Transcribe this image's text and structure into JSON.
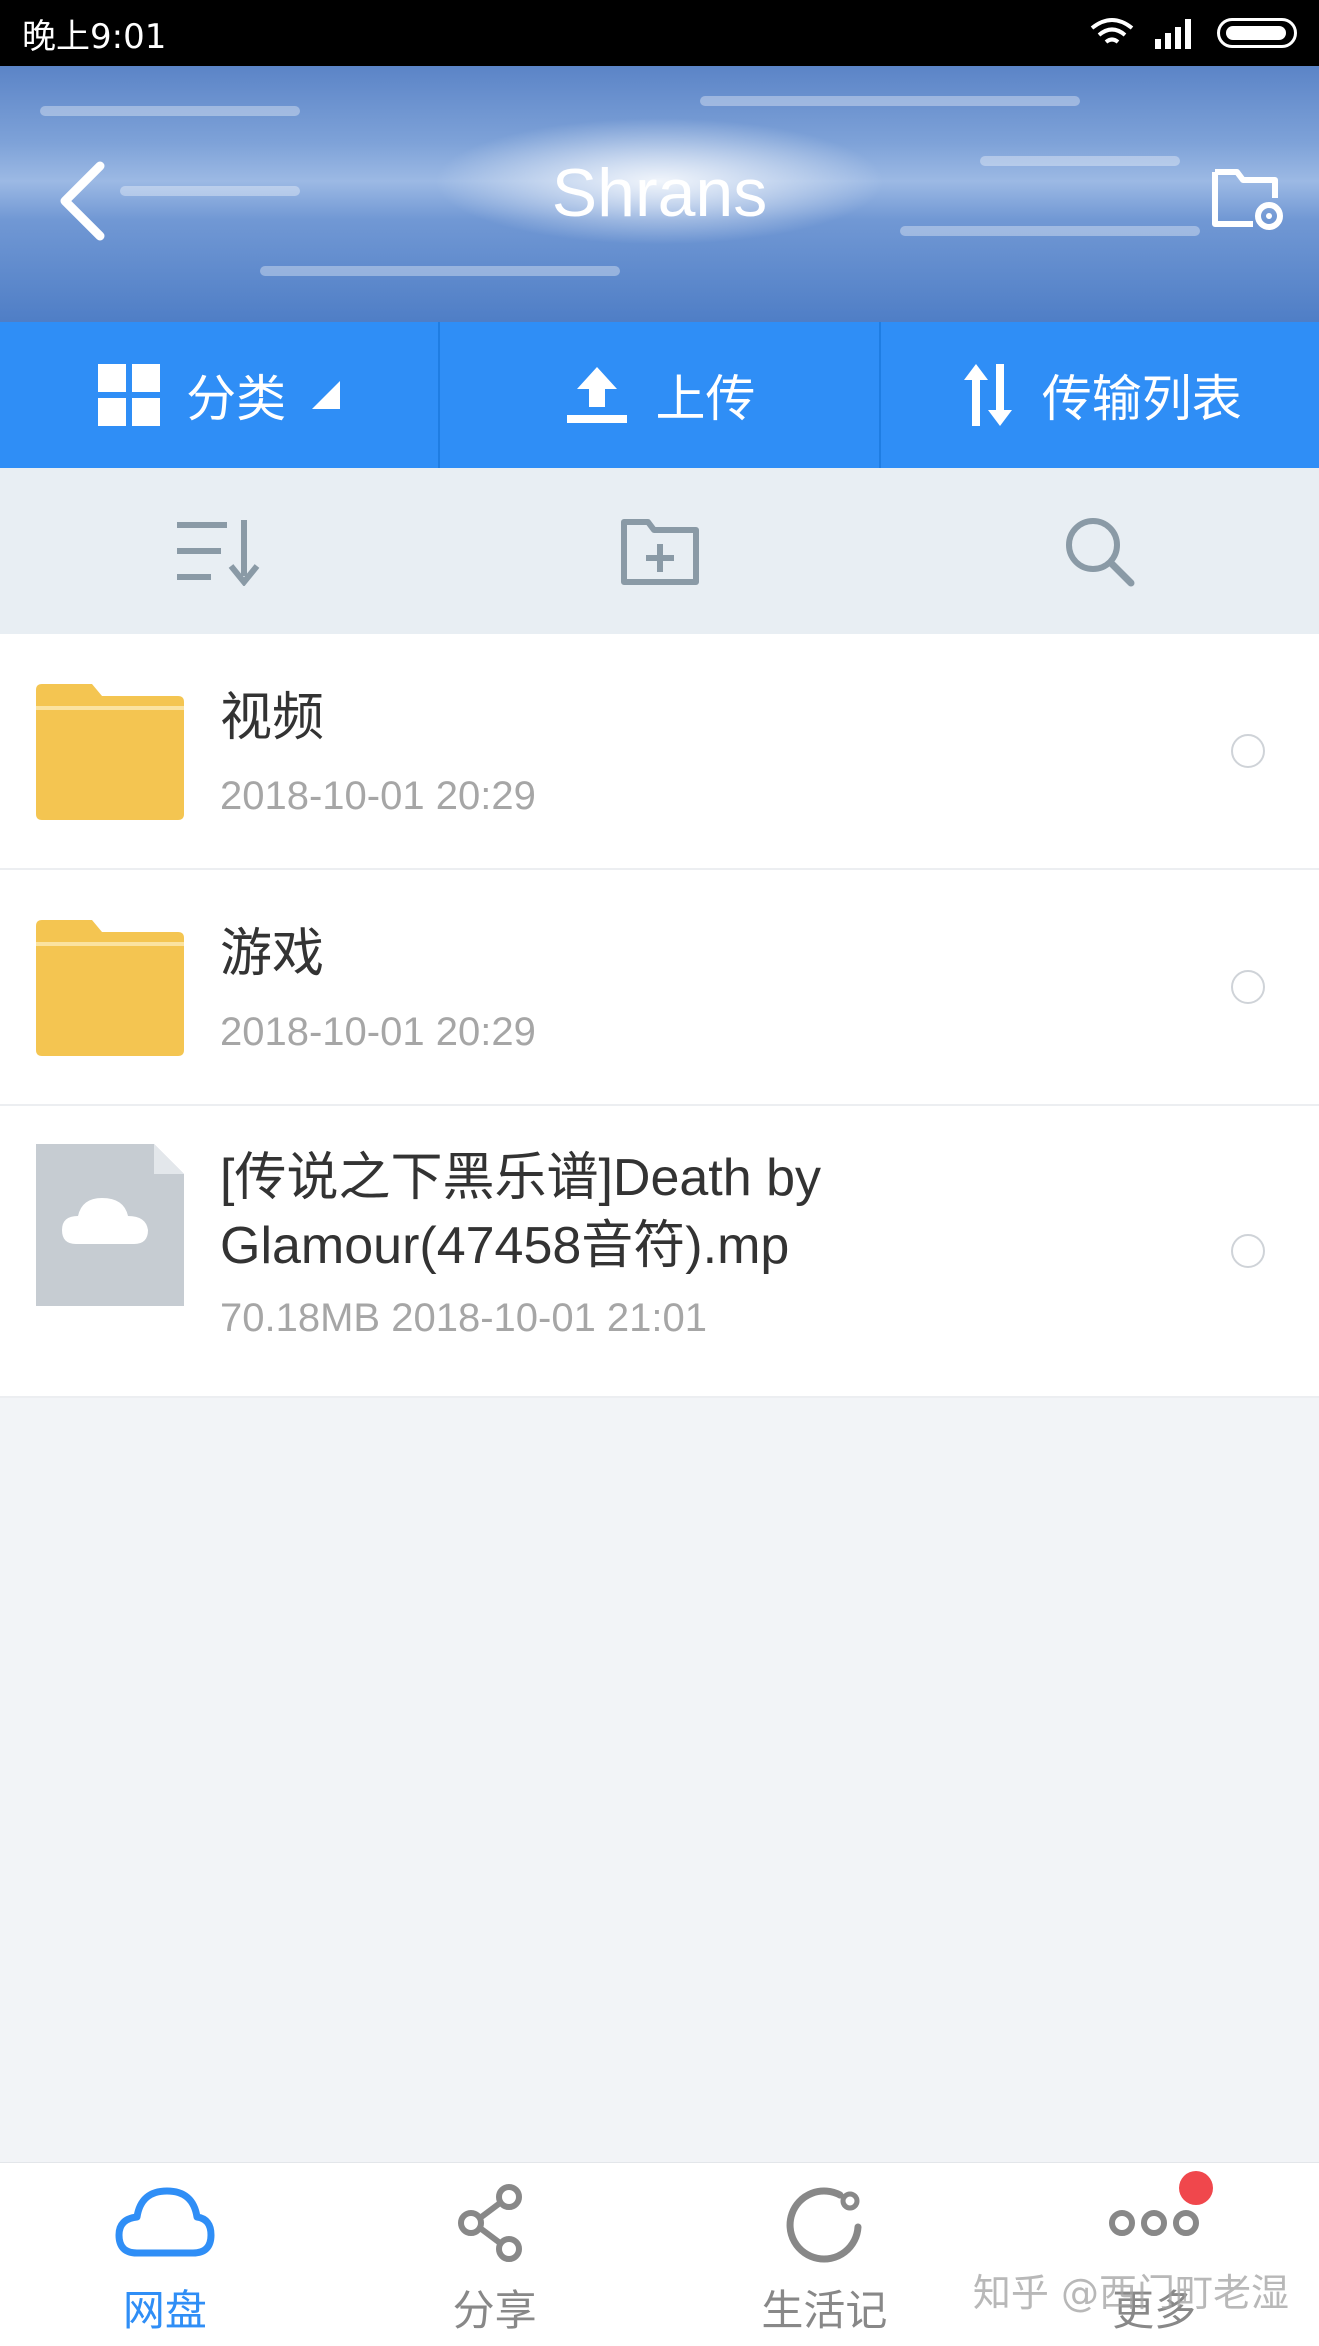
{
  "status_bar": {
    "time": "晚上9:01"
  },
  "header": {
    "title": "Shrans"
  },
  "action_bar": {
    "category_label": "分类",
    "upload_label": "上传",
    "transfer_label": "传输列表"
  },
  "files": [
    {
      "name": "视频",
      "meta": "2018-10-01   20:29",
      "type": "folder"
    },
    {
      "name": "游戏",
      "meta": "2018-10-01   20:29",
      "type": "folder"
    },
    {
      "name_line1": "[传说之下黑乐谱]Death by",
      "name_line2": "Glamour(47458音符).mp",
      "meta": "70.18MB   2018-10-01   21:01",
      "type": "cloud-file"
    }
  ],
  "bottom_nav": {
    "items": [
      {
        "label": "网盘",
        "icon": "cloud-icon",
        "active": true
      },
      {
        "label": "分享",
        "icon": "share-icon",
        "active": false
      },
      {
        "label": "生活记",
        "icon": "life-record-icon",
        "active": false
      },
      {
        "label": "更多",
        "icon": "more-icon",
        "active": false
      }
    ]
  },
  "watermark": "知乎 @西门町老湿",
  "colors": {
    "accent_blue": "#2f8ef6",
    "folder_yellow": "#f4c551",
    "badge_red": "#f0474c"
  }
}
